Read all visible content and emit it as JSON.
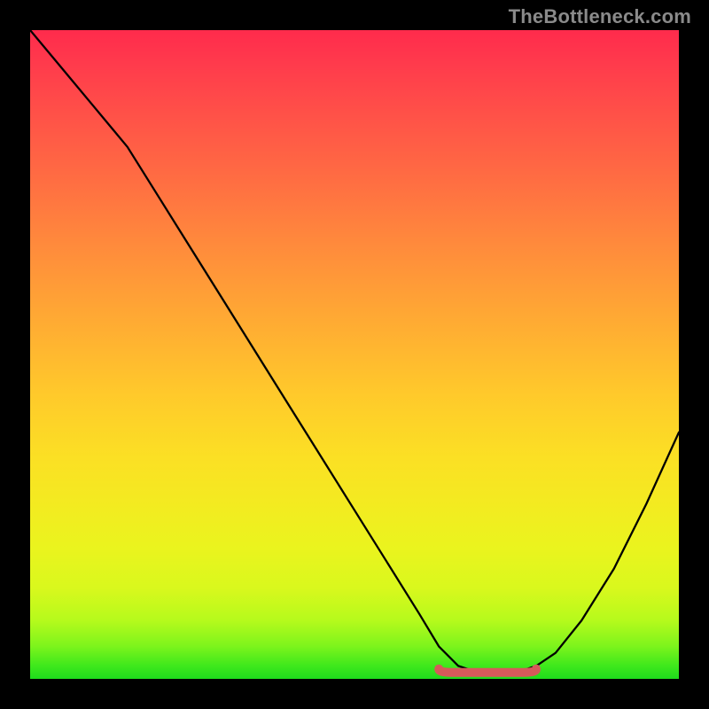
{
  "watermark": "TheBottleneck.com",
  "colors": {
    "page_bg": "#000000",
    "curve": "#000000",
    "highlight": "#d65a5a",
    "gradient_top": "#ff2b4c",
    "gradient_bottom": "#1fdc1c"
  },
  "chart_data": {
    "type": "line",
    "title": "",
    "xlabel": "",
    "ylabel": "",
    "xlim": [
      0,
      100
    ],
    "ylim": [
      0,
      100
    ],
    "grid": true,
    "legend": false,
    "series": [
      {
        "name": "bottleneck-curve",
        "x": [
          0,
          5,
          10,
          15,
          20,
          25,
          30,
          35,
          40,
          45,
          50,
          55,
          60,
          63,
          66,
          69,
          72,
          75,
          78,
          81,
          85,
          90,
          95,
          100
        ],
        "values": [
          100,
          94,
          88,
          82,
          74,
          66,
          58,
          50,
          42,
          34,
          26,
          18,
          10,
          5,
          2,
          1,
          1,
          1,
          2,
          4,
          9,
          17,
          27,
          38
        ]
      }
    ],
    "highlight_segment": {
      "x_start": 63,
      "x_end": 78,
      "y": 1
    }
  }
}
